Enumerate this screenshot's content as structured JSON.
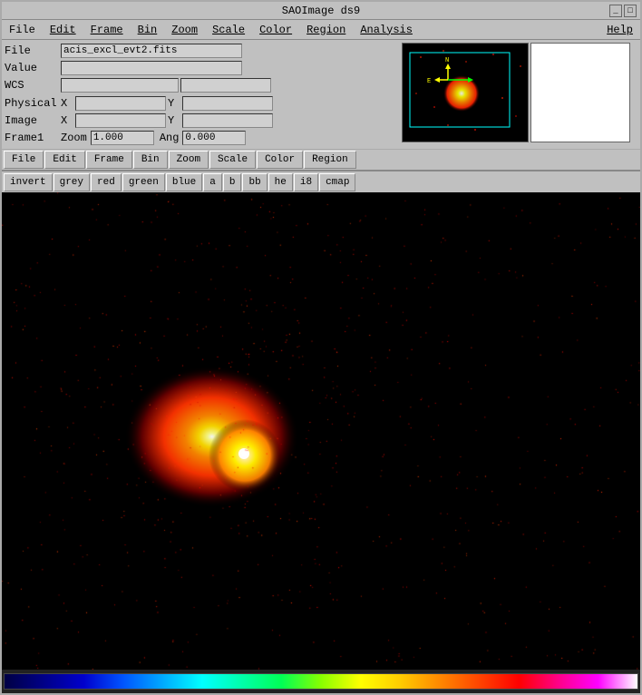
{
  "window": {
    "title": "SAOImage ds9"
  },
  "menu": {
    "items": [
      "File",
      "Edit",
      "Frame",
      "Bin",
      "Zoom",
      "Scale",
      "Color",
      "Region",
      "Analysis",
      "Help"
    ]
  },
  "info": {
    "file_label": "File",
    "file_value": "acis_excl_evt2.fits",
    "value_label": "Value",
    "value_value": "",
    "wcs_label": "WCS",
    "wcs_value": "",
    "wcs_value2": "",
    "physical_label": "Physical",
    "physical_x_label": "X",
    "physical_x_value": "",
    "physical_y_label": "Y",
    "physical_y_value": "",
    "image_label": "Image",
    "image_x_label": "X",
    "image_x_value": "",
    "image_y_label": "Y",
    "image_y_value": "",
    "frame_label": "Frame1",
    "zoom_label": "Zoom",
    "zoom_value": "1.000",
    "ang_label": "Ang",
    "ang_value": "0.000"
  },
  "toolbar": {
    "buttons": [
      "File",
      "Edit",
      "Frame",
      "Bin",
      "Zoom",
      "Scale",
      "Color",
      "Region"
    ]
  },
  "colormap": {
    "buttons": [
      "invert",
      "grey",
      "red",
      "green",
      "blue",
      "a",
      "b",
      "bb",
      "he",
      "i8",
      "cmap"
    ]
  }
}
